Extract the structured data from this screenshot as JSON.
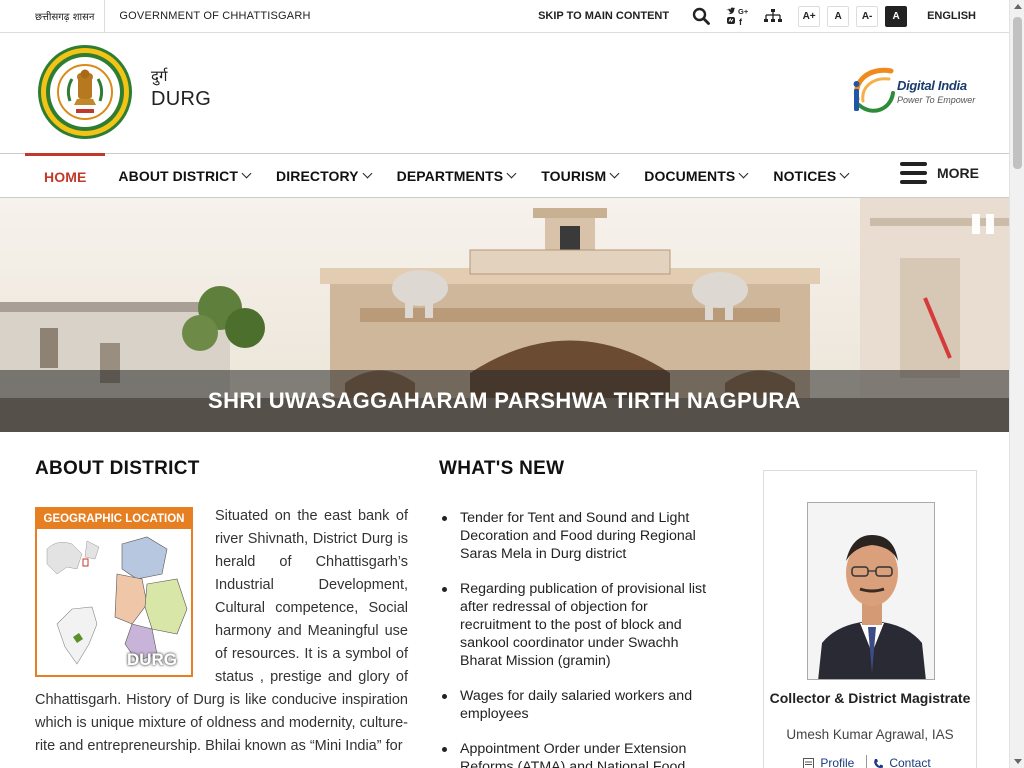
{
  "topbar": {
    "govt_hindi": "छत्तीसगढ़ शासन",
    "govt_english": "GOVERNMENT OF CHHATTISGARH",
    "skip_link": "SKIP TO MAIN CONTENT",
    "font_sizes": [
      "A+",
      "A",
      "A-",
      "A"
    ],
    "language": "ENGLISH"
  },
  "header": {
    "site_name_hindi": "दुर्ग",
    "site_name_english": "DURG",
    "digital_india_title": "Digital India",
    "digital_india_tagline": "Power To Empower"
  },
  "nav": {
    "items": [
      {
        "label": "HOME",
        "active": true,
        "has_dropdown": false
      },
      {
        "label": "ABOUT DISTRICT",
        "has_dropdown": true
      },
      {
        "label": "DIRECTORY",
        "has_dropdown": true
      },
      {
        "label": "DEPARTMENTS",
        "has_dropdown": true
      },
      {
        "label": "TOURISM",
        "has_dropdown": true
      },
      {
        "label": "DOCUMENTS",
        "has_dropdown": true
      },
      {
        "label": "NOTICES",
        "has_dropdown": true
      }
    ],
    "more_label": "MORE"
  },
  "banner": {
    "caption": "SHRI UWASAGGAHARAM PARSHWA TIRTH NAGPURA"
  },
  "about": {
    "title": "ABOUT DISTRICT",
    "map_header": "GEOGRAPHIC LOCATION",
    "map_district": "DURG",
    "body": "Situated on the east bank of river Shivnath, District Durg is herald of Chhattisgarh’s Industrial Development, Cultural competence, Social harmony and Meaningful use of resources. It is a symbol of status , prestige and glory of Chhattisgarh. History of Durg is like conducive inspiration which is unique mixture of oldness and modernity, culture-rite and entrepreneurship. Bhilai known as “Mini India” for"
  },
  "whats_new": {
    "title": "WHAT'S NEW",
    "items": [
      "Tender for Tent and Sound and Light Decoration and Food during Regional Saras Mela in Durg district",
      "Regarding publication of provisional list after redressal of objection for recruitment to the post of block and sankool coordinator under Swachh Bharat Mission (gramin)",
      "Wages for daily salaried workers and employees",
      "Appointment Order under Extension Reforms (ATMA) and National Food"
    ]
  },
  "official": {
    "role": "Collector & District Magistrate",
    "name": "Umesh Kumar Agrawal, IAS",
    "profile_label": "Profile",
    "contact_label": "Contact"
  },
  "colors": {
    "accent": "#c0392b",
    "map_orange": "#e67e22",
    "link_blue": "#1a3c7e"
  }
}
